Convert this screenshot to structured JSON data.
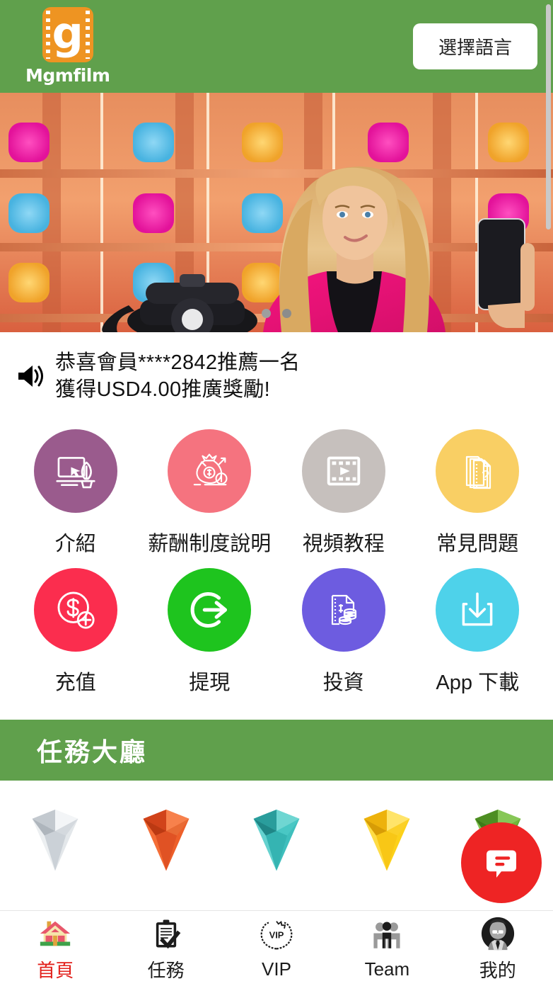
{
  "header": {
    "brand_name": "Mgmfilm",
    "logo_letter": "g",
    "language_button": "選擇語言",
    "bg_color": "#60a04c",
    "logo_color": "#ee9422"
  },
  "banner": {
    "alt": "game-show-set-woman-pink-blazer-holding-phone",
    "dots": [
      {
        "active": true
      },
      {
        "active": false
      }
    ]
  },
  "announcement": {
    "icon": "speaker-icon",
    "line1": "恭喜會員****2842推薦一名",
    "line2": "獲得USD4.00推廣獎勵!"
  },
  "menu": {
    "items": [
      {
        "label": "介紹",
        "icon": "monitor-plant-icon",
        "color": "#9a5b8d"
      },
      {
        "label": "薪酬制度說明",
        "icon": "money-bag-icon",
        "color": "#f5737f"
      },
      {
        "label": "視頻教程",
        "icon": "film-play-icon",
        "color": "#c6c0bd"
      },
      {
        "label": "常見問題",
        "icon": "document-question-icon",
        "color": "#f9cf64"
      },
      {
        "label": "充值",
        "icon": "dollar-plus-icon",
        "color": "#fb2d4e"
      },
      {
        "label": "提現",
        "icon": "arrow-out-circle-icon",
        "color": "#1ec41e"
      },
      {
        "label": "投資",
        "icon": "document-coins-icon",
        "color": "#6d5ce0"
      },
      {
        "label": "App 下載",
        "icon": "download-icon",
        "color": "#4ed2ea"
      }
    ]
  },
  "task_section": {
    "title": "任務大廳",
    "bg_color": "#60a04c"
  },
  "diamonds": [
    {
      "name": "diamond-silver",
      "color": "#cfd3d8"
    },
    {
      "name": "diamond-orange",
      "color": "#ec5a23"
    },
    {
      "name": "diamond-teal",
      "color": "#33b3b5"
    },
    {
      "name": "diamond-gold",
      "color": "#fcd116"
    },
    {
      "name": "diamond-green",
      "color": "#5fab2e"
    }
  ],
  "fab": {
    "icon": "chat-bubble-icon",
    "color": "#ee2424"
  },
  "bottom_nav": {
    "items": [
      {
        "label": "首頁",
        "icon": "house-icon",
        "active": true
      },
      {
        "label": "任務",
        "icon": "clipboard-check-icon",
        "active": false
      },
      {
        "label": "VIP",
        "icon": "vip-wreath-icon",
        "active": false
      },
      {
        "label": "Team",
        "icon": "people-icon",
        "active": false
      },
      {
        "label": "我的",
        "icon": "avatar-icon",
        "active": false
      }
    ],
    "active_color": "#e2201b"
  }
}
